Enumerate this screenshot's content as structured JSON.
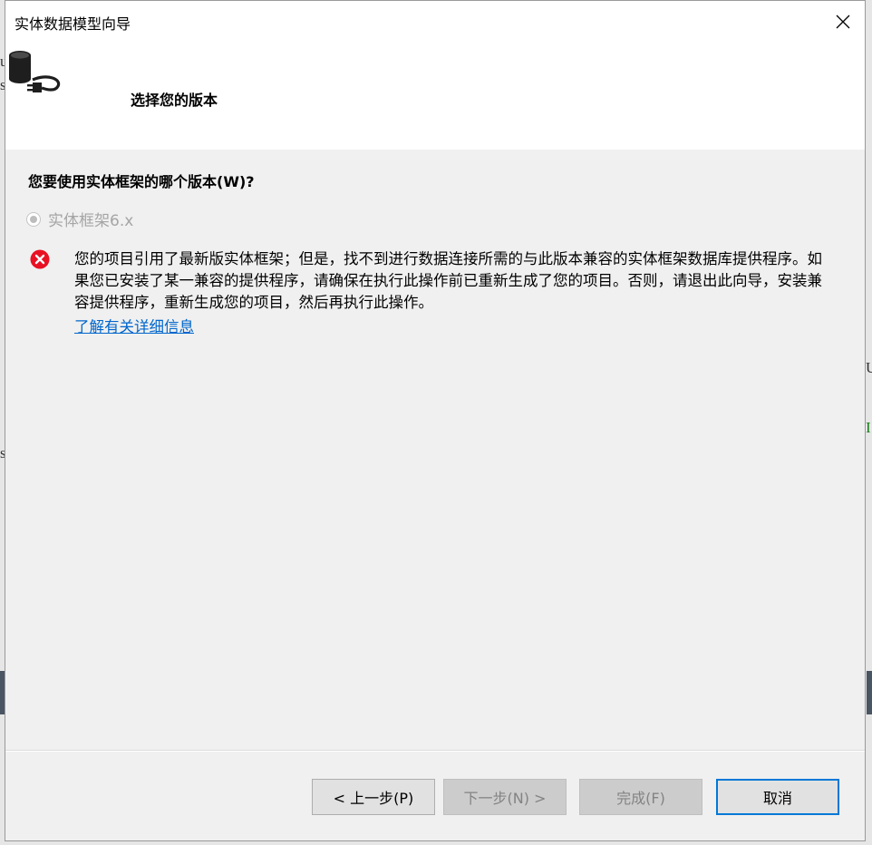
{
  "background_fragments": {
    "left_a": "•",
    "left_b": "u",
    "left_c": "s",
    "left_d": "s",
    "right_a": "U",
    "right_b": "I"
  },
  "dialog": {
    "title": "实体数据模型向导",
    "header_title": "选择您的版本",
    "question": "您要使用实体框架的哪个版本(W)?",
    "radio_option": {
      "label": "实体框架6.x",
      "checked": true,
      "disabled": true
    },
    "error_message": "您的项目引用了最新版实体框架；但是，找不到进行数据连接所需的与此版本兼容的实体框架数据库提供程序。如果您已安装了某一兼容的提供程序，请确保在执行此操作前已重新生成了您的项目。否则，请退出此向导，安装兼容提供程序，重新生成您的项目，然后再执行此操作。",
    "learn_more_link": "了解有关详细信息",
    "buttons": {
      "back": "< 上一步(P)",
      "next": "下一步(N) >",
      "finish": "完成(F)",
      "cancel": "取消"
    }
  },
  "icons": {
    "header": "database-plug-icon",
    "error": "error-x-icon",
    "close": "close-icon"
  },
  "colors": {
    "error_red": "#e81123",
    "link_blue": "#0066cc",
    "focus_blue": "#0078d7"
  }
}
